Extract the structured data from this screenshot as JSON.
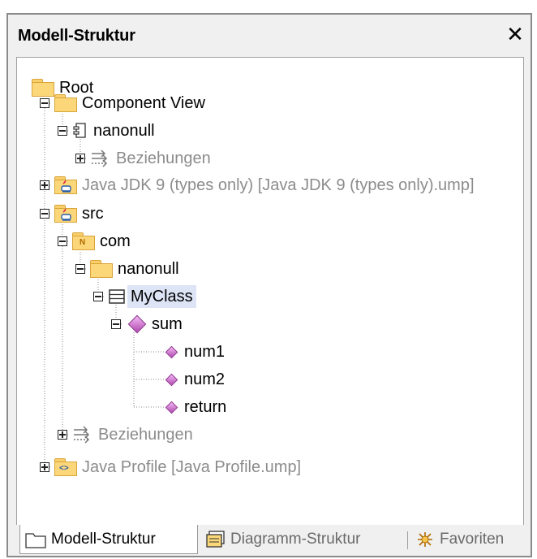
{
  "panel": {
    "title": "Modell-Struktur",
    "close_glyph": "✕"
  },
  "tree": {
    "root": "Root",
    "component_view": "Component View",
    "nanonull_component": "nanonull",
    "beziehungen_1": "Beziehungen",
    "java_jdk": "Java JDK 9 (types only) [Java JDK 9 (types only).ump]",
    "src": "src",
    "com": "com",
    "nanonull_package": "nanonull",
    "myclass": "MyClass",
    "sum": "sum",
    "num1": "num1",
    "num2": "num2",
    "return": "return",
    "beziehungen_2": "Beziehungen",
    "java_profile": "Java Profile [Java Profile.ump]"
  },
  "icons": {
    "package_badge": "N",
    "profile_badge": "<>"
  },
  "tabs": [
    {
      "label": "Modell-Struktur",
      "icon": "folder-icon"
    },
    {
      "label": "Diagramm-Struktur",
      "icon": "diagram-tree-icon"
    },
    {
      "label": "Favoriten",
      "icon": "star-icon"
    }
  ],
  "colors": {
    "selection": "#dde4f6",
    "folder": "#fbd779",
    "operation": "#c060c0"
  }
}
